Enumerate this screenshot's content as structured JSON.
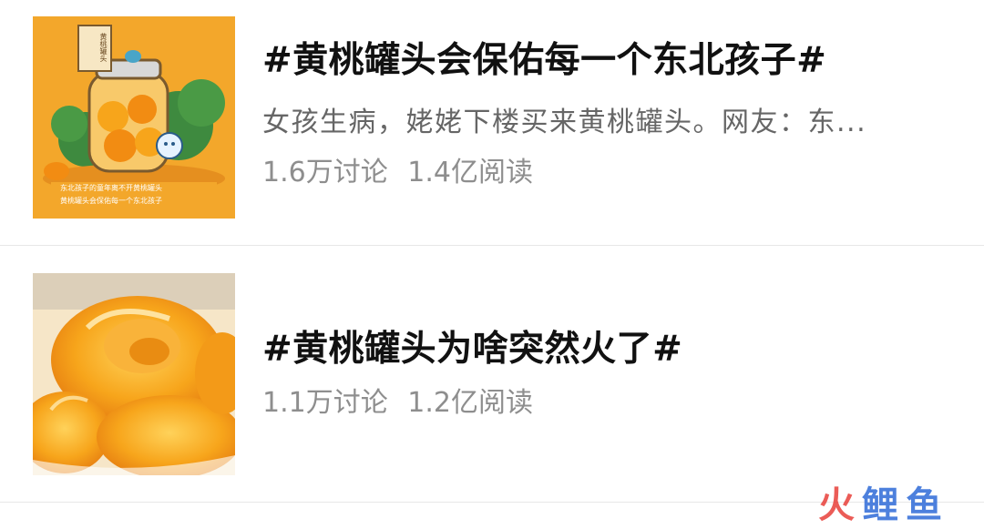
{
  "topics": [
    {
      "title": "#黄桃罐头会保佑每一个东北孩子#",
      "summary": "女孩生病，姥姥下楼买来黄桃罐头。网友：东...",
      "discussions": "1.6万讨论",
      "reads": "1.4亿阅读",
      "thumb_text_badge": "黄桃罐头",
      "thumb_text_line1": "东北孩子的童年离不开黄桃罐头",
      "thumb_text_line2": "黄桃罐头会保佑每一个东北孩子"
    },
    {
      "title": "#黄桃罐头为啥突然火了#",
      "discussions": "1.1万讨论",
      "reads": "1.2亿阅读"
    }
  ],
  "watermark": {
    "text": "火鲤鱼"
  },
  "colors": {
    "title": "#111111",
    "summary": "#666666",
    "stats": "#8e8e8e",
    "divider": "#e7e7e7",
    "thumb1_bg": "#F3A72B",
    "peach": "#F7A51B",
    "watermark_red": "#E8403A",
    "watermark_blue": "#2E6BD8"
  }
}
